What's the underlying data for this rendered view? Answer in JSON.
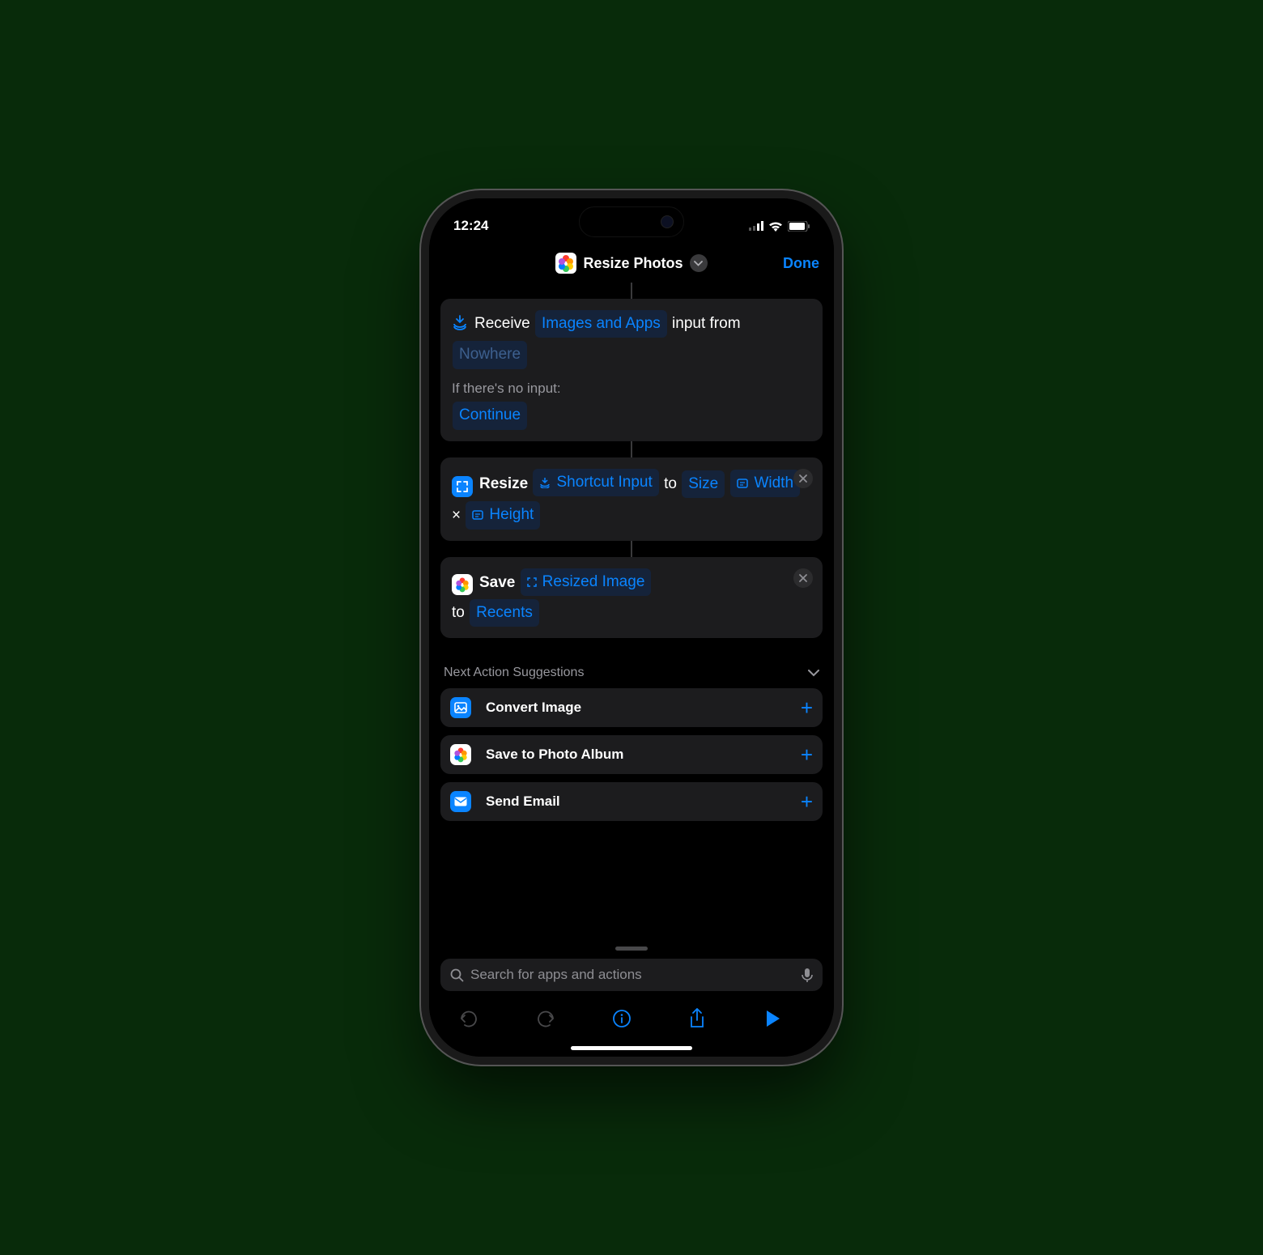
{
  "status": {
    "time": "12:24"
  },
  "nav": {
    "title": "Resize Photos",
    "done": "Done"
  },
  "receive": {
    "word_receive": "Receive",
    "token_types": "Images and Apps",
    "word_input_from": "input from",
    "token_source": "Nowhere",
    "no_input_label": "If there's no input:",
    "no_input_action": "Continue"
  },
  "resize": {
    "word_resize": "Resize",
    "token_input": "Shortcut Input",
    "word_to": "to",
    "token_size": "Size",
    "token_width": "Width",
    "sep": "×",
    "token_height": "Height"
  },
  "save": {
    "word_save": "Save",
    "token_image": "Resized Image",
    "word_to": "to",
    "token_album": "Recents"
  },
  "suggestions": {
    "header": "Next Action Suggestions",
    "items": [
      {
        "label": "Convert Image"
      },
      {
        "label": "Save to Photo Album"
      },
      {
        "label": "Send Email"
      }
    ]
  },
  "search": {
    "placeholder": "Search for apps and actions"
  }
}
